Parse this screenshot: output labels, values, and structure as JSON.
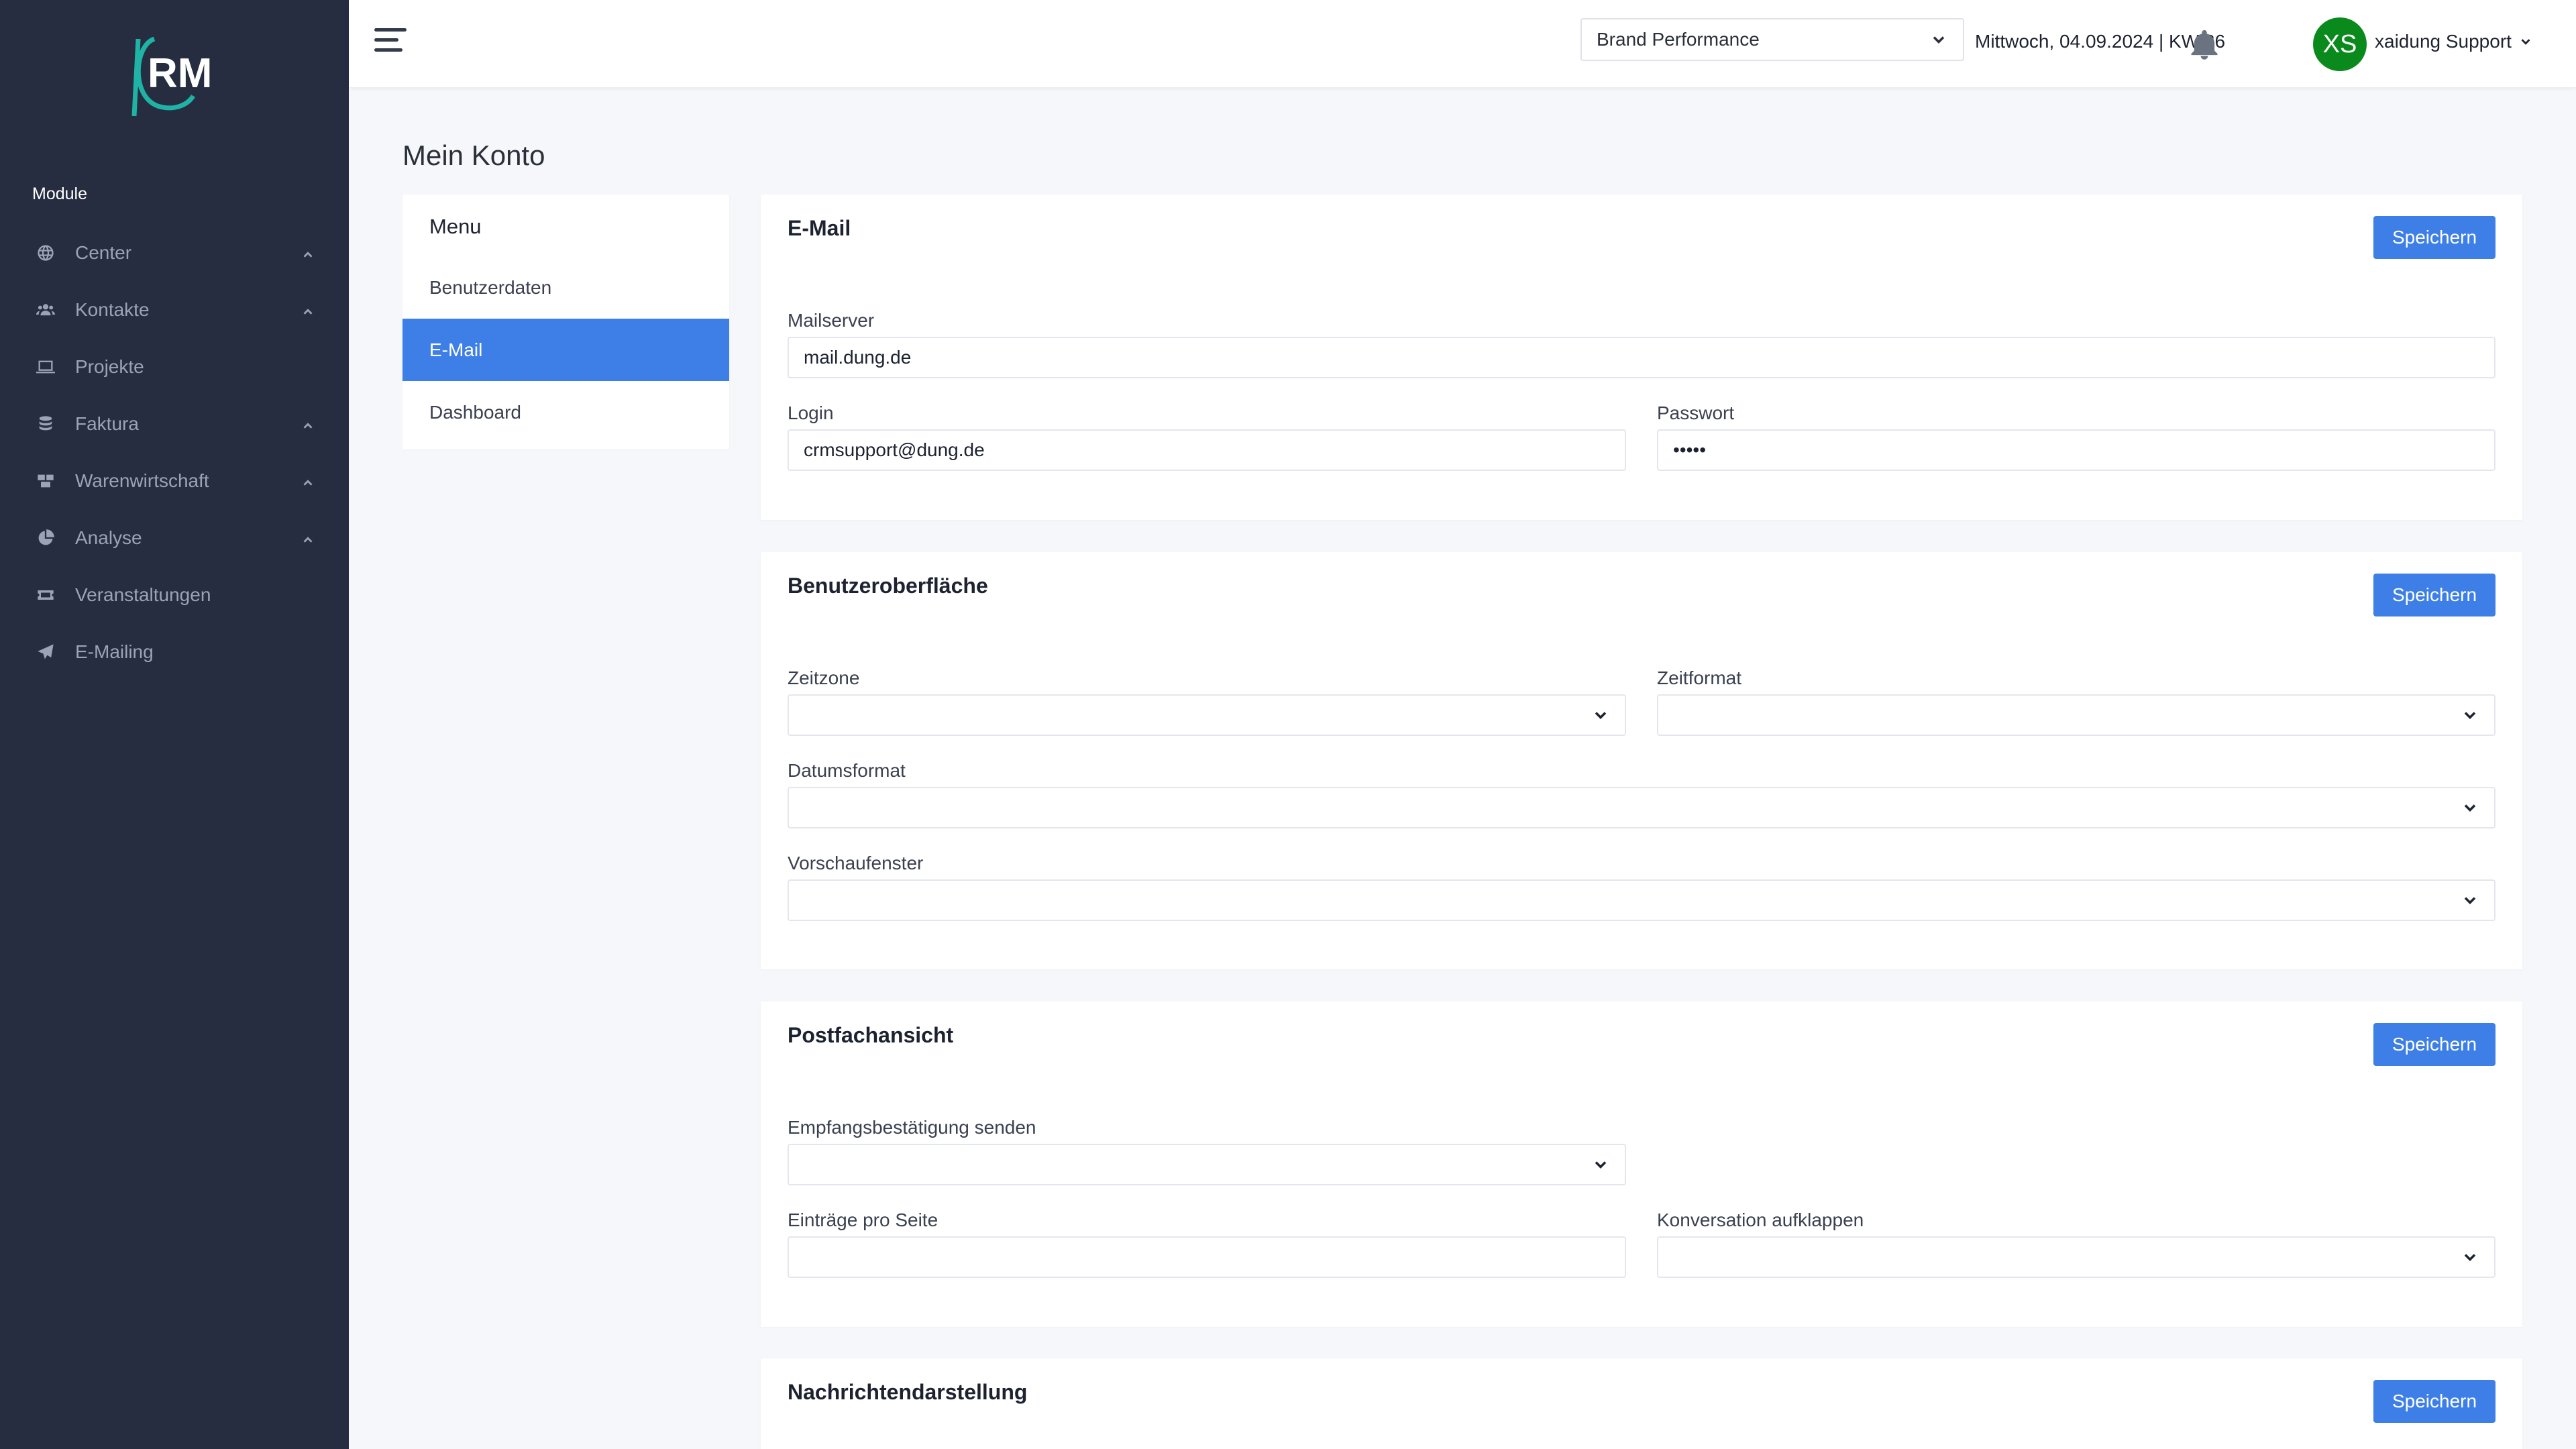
{
  "sidebar": {
    "section_label": "Module",
    "items": [
      {
        "label": "Center",
        "icon": "globe-icon",
        "expandable": true
      },
      {
        "label": "Kontakte",
        "icon": "users-icon",
        "expandable": true
      },
      {
        "label": "Projekte",
        "icon": "laptop-icon",
        "expandable": false
      },
      {
        "label": "Faktura",
        "icon": "coins-icon",
        "expandable": true
      },
      {
        "label": "Warenwirtschaft",
        "icon": "boxes-icon",
        "expandable": true
      },
      {
        "label": "Analyse",
        "icon": "pie-chart-icon",
        "expandable": true
      },
      {
        "label": "Veranstaltungen",
        "icon": "ticket-icon",
        "expandable": false
      },
      {
        "label": "E-Mailing",
        "icon": "paper-plane-icon",
        "expandable": false
      }
    ]
  },
  "topbar": {
    "brand_select_value": "Brand Performance",
    "date_text": "Mittwoch, 04.09.2024 | KW 36",
    "avatar_initials": "XS",
    "user_name": "xaidung Support",
    "avatar_color": "#0a8a1c"
  },
  "page": {
    "title": "Mein Konto"
  },
  "menu": {
    "title": "Menu",
    "items": [
      {
        "label": "Benutzerdaten",
        "active": false
      },
      {
        "label": "E-Mail",
        "active": true
      },
      {
        "label": "Dashboard",
        "active": false
      }
    ]
  },
  "email_card": {
    "title": "E-Mail",
    "save_label": "Speichern",
    "mailserver_label": "Mailserver",
    "mailserver_value": "mail.dung.de",
    "login_label": "Login",
    "login_value": "crmsupport@dung.de",
    "password_label": "Passwort",
    "password_value": "•••••"
  },
  "ui_card": {
    "title": "Benutzeroberfläche",
    "save_label": "Speichern",
    "timezone_label": "Zeitzone",
    "timeformat_label": "Zeitformat",
    "dateformat_label": "Datumsformat",
    "preview_label": "Vorschaufenster"
  },
  "inbox_card": {
    "title": "Postfachansicht",
    "save_label": "Speichern",
    "receipt_label": "Empfangsbestätigung senden",
    "per_page_label": "Einträge pro Seite",
    "conversation_label": "Konversation aufklappen"
  },
  "message_card": {
    "title": "Nachrichtendarstellung",
    "save_label": "Speichern"
  },
  "colors": {
    "sidebar_bg": "#262d40",
    "accent": "#3d7fe6",
    "logo_teal": "#1fb3a6"
  }
}
